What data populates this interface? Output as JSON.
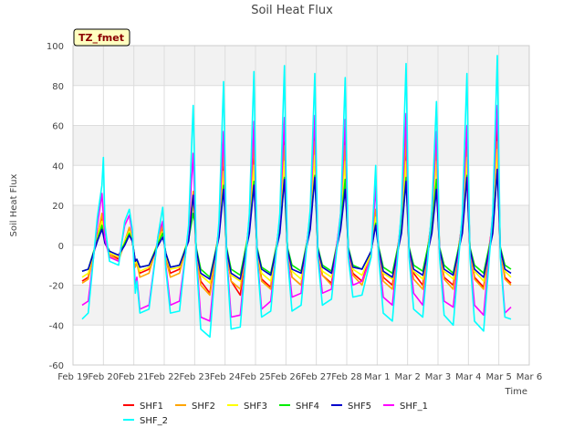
{
  "chart_data": {
    "type": "line",
    "title": "Soil Heat Flux",
    "xlabel": "Time",
    "ylabel": "Soil Heat Flux",
    "site_label": "TZ_fmet",
    "ylim": [
      -60,
      100
    ],
    "yticks": [
      -60,
      -40,
      -20,
      0,
      20,
      40,
      60,
      80,
      100
    ],
    "xlim": [
      0,
      15
    ],
    "xtick_labels": [
      "Feb 19",
      "Feb 20",
      "Feb 21",
      "Feb 22",
      "Feb 23",
      "Feb 24",
      "Feb 25",
      "Feb 26",
      "Feb 27",
      "Feb 28",
      "Mar 1",
      "Mar 2",
      "Mar 3",
      "Mar 4",
      "Mar 5",
      "Mar 6"
    ],
    "grid": true,
    "shaded_bands": true,
    "legend_position": "bottom",
    "x_unit": "days since Feb 19",
    "series": [
      {
        "name": "SHF1",
        "color": "#ff0000",
        "x": [
          0.3,
          0.5,
          0.8,
          0.95,
          1.0,
          1.05,
          1.2,
          1.5,
          1.7,
          1.85,
          1.95,
          2.05,
          2.1,
          2.2,
          2.5,
          2.8,
          2.95,
          3.0,
          3.05,
          3.2,
          3.5,
          3.8,
          3.95,
          4.0,
          4.05,
          4.2,
          4.5,
          4.8,
          4.95,
          5.0,
          5.05,
          5.2,
          5.5,
          5.8,
          5.95,
          6.0,
          6.05,
          6.2,
          6.5,
          6.8,
          6.95,
          7.0,
          7.05,
          7.2,
          7.5,
          7.8,
          7.95,
          8.0,
          8.05,
          8.2,
          8.5,
          8.8,
          8.95,
          9.0,
          9.05,
          9.2,
          9.5,
          9.8,
          9.95,
          10.0,
          10.05,
          10.2,
          10.5,
          10.8,
          10.95,
          11.0,
          11.05,
          11.2,
          11.5,
          11.8,
          11.95,
          12.0,
          12.05,
          12.2,
          12.5,
          12.8,
          12.95,
          13.0,
          13.05,
          13.2,
          13.5,
          13.8,
          13.95,
          14.0,
          14.05,
          14.2,
          14.4
        ],
        "y": [
          -18,
          -16,
          5,
          14,
          8,
          3,
          -4,
          -7,
          2,
          8,
          3,
          -10,
          -8,
          -14,
          -12,
          2,
          8,
          2,
          -6,
          -14,
          -12,
          4,
          25,
          20,
          -2,
          -18,
          -24,
          8,
          45,
          20,
          -2,
          -18,
          -25,
          12,
          50,
          20,
          -2,
          -17,
          -21,
          12,
          52,
          22,
          -2,
          -16,
          -20,
          14,
          55,
          25,
          -2,
          -15,
          -19,
          14,
          52,
          22,
          -2,
          -14,
          -18,
          -4,
          16,
          8,
          -2,
          -16,
          -20,
          12,
          52,
          22,
          -2,
          -14,
          -20,
          14,
          52,
          22,
          -2,
          -16,
          -20,
          12,
          54,
          25,
          -2,
          -16,
          -21,
          12,
          60,
          28,
          -2,
          -16,
          -19
        ]
      },
      {
        "name": "SHF2",
        "color": "#ffa500",
        "x": [
          0.3,
          0.5,
          0.8,
          0.95,
          1.0,
          1.05,
          1.2,
          1.5,
          1.7,
          1.85,
          1.95,
          2.05,
          2.1,
          2.2,
          2.5,
          2.8,
          2.95,
          3.0,
          3.05,
          3.2,
          3.5,
          3.8,
          3.95,
          4.0,
          4.05,
          4.2,
          4.5,
          4.8,
          4.95,
          5.0,
          5.05,
          5.2,
          5.5,
          5.8,
          5.95,
          6.0,
          6.05,
          6.2,
          6.5,
          6.8,
          6.95,
          7.0,
          7.05,
          7.2,
          7.5,
          7.8,
          7.95,
          8.0,
          8.05,
          8.2,
          8.5,
          8.8,
          8.95,
          9.0,
          9.05,
          9.2,
          9.5,
          9.8,
          9.95,
          10.0,
          10.05,
          10.2,
          10.5,
          10.8,
          10.95,
          11.0,
          11.05,
          11.2,
          11.5,
          11.8,
          11.95,
          12.0,
          12.05,
          12.2,
          12.5,
          12.8,
          12.95,
          13.0,
          13.05,
          13.2,
          13.5,
          13.8,
          13.95,
          14.0,
          14.05,
          14.2,
          14.4
        ],
        "y": [
          -19,
          -17,
          4,
          16,
          9,
          2,
          -5,
          -8,
          2,
          9,
          3,
          -11,
          -9,
          -16,
          -14,
          2,
          10,
          2,
          -7,
          -16,
          -14,
          4,
          27,
          20,
          -2,
          -20,
          -25,
          6,
          49,
          20,
          -2,
          -18,
          -22,
          10,
          54,
          20,
          -2,
          -18,
          -22,
          10,
          50,
          20,
          -2,
          -16,
          -20,
          12,
          52,
          24,
          -2,
          -15,
          -20,
          12,
          50,
          22,
          -2,
          -15,
          -20,
          -4,
          18,
          8,
          -2,
          -18,
          -22,
          10,
          55,
          22,
          -2,
          -17,
          -22,
          12,
          50,
          22,
          -2,
          -17,
          -22,
          10,
          52,
          24,
          -2,
          -17,
          -22,
          10,
          52,
          26,
          -2,
          -17,
          -20
        ]
      },
      {
        "name": "SHF3",
        "color": "#ffff00",
        "x": [
          0.3,
          0.5,
          0.8,
          0.95,
          1.0,
          1.05,
          1.2,
          1.5,
          1.7,
          1.85,
          1.95,
          2.05,
          2.1,
          2.2,
          2.5,
          2.8,
          2.95,
          3.0,
          3.05,
          3.2,
          3.5,
          3.8,
          3.95,
          4.0,
          4.05,
          4.2,
          4.5,
          4.8,
          4.95,
          5.0,
          5.05,
          5.2,
          5.5,
          5.8,
          5.95,
          6.0,
          6.05,
          6.2,
          6.5,
          6.8,
          6.95,
          7.0,
          7.05,
          7.2,
          7.5,
          7.8,
          7.95,
          8.0,
          8.05,
          8.2,
          8.5,
          8.8,
          8.95,
          9.0,
          9.05,
          9.2,
          9.5,
          9.8,
          9.95,
          10.0,
          10.05,
          10.2,
          10.5,
          10.8,
          10.95,
          11.0,
          11.05,
          11.2,
          11.5,
          11.8,
          11.95,
          12.0,
          12.05,
          12.2,
          12.5,
          12.8,
          12.95,
          13.0,
          13.05,
          13.2,
          13.5,
          13.8,
          13.95,
          14.0,
          14.05,
          14.2,
          14.4
        ],
        "y": [
          -16,
          -14,
          4,
          12,
          7,
          2,
          -4,
          -6,
          2,
          7,
          2,
          -9,
          -8,
          -13,
          -11,
          2,
          7,
          2,
          -5,
          -12,
          -11,
          4,
          20,
          15,
          -2,
          -15,
          -19,
          6,
          37,
          16,
          -2,
          -15,
          -18,
          10,
          40,
          18,
          -2,
          -14,
          -18,
          10,
          42,
          18,
          -2,
          -13,
          -17,
          12,
          45,
          20,
          -2,
          -13,
          -16,
          12,
          42,
          18,
          -2,
          -12,
          -15,
          -4,
          14,
          7,
          -2,
          -14,
          -17,
          10,
          42,
          18,
          -2,
          -13,
          -17,
          12,
          42,
          18,
          -2,
          -13,
          -17,
          10,
          44,
          20,
          -2,
          -13,
          -18,
          10,
          48,
          22,
          -2,
          -13,
          -16
        ]
      },
      {
        "name": "SHF4",
        "color": "#00ee00",
        "x": [
          0.3,
          0.5,
          0.8,
          0.95,
          1.0,
          1.05,
          1.2,
          1.5,
          1.7,
          1.85,
          1.95,
          2.05,
          2.1,
          2.2,
          2.5,
          2.8,
          2.95,
          3.0,
          3.05,
          3.2,
          3.5,
          3.8,
          3.95,
          4.0,
          4.05,
          4.2,
          4.5,
          4.8,
          4.95,
          5.0,
          5.05,
          5.2,
          5.5,
          5.8,
          5.95,
          6.0,
          6.05,
          6.2,
          6.5,
          6.8,
          6.95,
          7.0,
          7.05,
          7.2,
          7.5,
          7.8,
          7.95,
          8.0,
          8.05,
          8.2,
          8.5,
          8.8,
          8.95,
          9.0,
          9.05,
          9.2,
          9.5,
          9.8,
          9.95,
          10.0,
          10.05,
          10.2,
          10.5,
          10.8,
          10.95,
          11.0,
          11.05,
          11.2,
          11.5,
          11.8,
          11.95,
          12.0,
          12.05,
          12.2,
          12.5,
          12.8,
          12.95,
          13.0,
          13.05,
          13.2,
          13.5,
          13.8,
          13.95,
          14.0,
          14.05,
          14.2,
          14.4
        ],
        "y": [
          -13,
          -12,
          3,
          10,
          6,
          2,
          -3,
          -5,
          1,
          6,
          2,
          -8,
          -7,
          -11,
          -10,
          1,
          6,
          1,
          -4,
          -11,
          -10,
          3,
          16,
          12,
          -1,
          -12,
          -16,
          5,
          30,
          12,
          -1,
          -12,
          -15,
          8,
          32,
          14,
          -1,
          -11,
          -14,
          8,
          34,
          14,
          -1,
          -10,
          -13,
          10,
          35,
          16,
          -1,
          -10,
          -13,
          10,
          33,
          14,
          -1,
          -10,
          -12,
          -3,
          11,
          5,
          -1,
          -11,
          -14,
          8,
          34,
          14,
          -1,
          -10,
          -13,
          9,
          33,
          14,
          -1,
          -10,
          -14,
          8,
          35,
          16,
          -1,
          -10,
          -14,
          8,
          38,
          18,
          -1,
          -10,
          -12
        ]
      },
      {
        "name": "SHF5",
        "color": "#0000cc",
        "x": [
          0.3,
          0.5,
          0.8,
          0.95,
          1.0,
          1.05,
          1.2,
          1.5,
          1.7,
          1.85,
          1.95,
          2.05,
          2.1,
          2.2,
          2.5,
          2.8,
          2.95,
          3.0,
          3.05,
          3.2,
          3.5,
          3.8,
          3.95,
          4.0,
          4.05,
          4.2,
          4.5,
          4.8,
          4.95,
          5.0,
          5.05,
          5.2,
          5.5,
          5.8,
          5.95,
          6.0,
          6.05,
          6.2,
          6.5,
          6.8,
          6.95,
          7.0,
          7.05,
          7.2,
          7.5,
          7.8,
          7.95,
          8.0,
          8.05,
          8.2,
          8.5,
          8.8,
          8.95,
          9.0,
          9.05,
          9.2,
          9.5,
          9.8,
          9.95,
          10.0,
          10.05,
          10.2,
          10.5,
          10.8,
          10.95,
          11.0,
          11.05,
          11.2,
          11.5,
          11.8,
          11.95,
          12.0,
          12.05,
          12.2,
          12.5,
          12.8,
          12.95,
          13.0,
          13.05,
          13.2,
          13.5,
          13.8,
          13.95,
          14.0,
          14.05,
          14.2,
          14.4
        ],
        "y": [
          -13,
          -12,
          2,
          8,
          5,
          1,
          -3,
          -5,
          0,
          5,
          2,
          -8,
          -7,
          -11,
          -10,
          0,
          4,
          1,
          -4,
          -11,
          -10,
          2,
          25,
          16,
          -2,
          -14,
          -17,
          4,
          28,
          16,
          -2,
          -14,
          -17,
          6,
          30,
          16,
          -2,
          -12,
          -15,
          6,
          33,
          18,
          -2,
          -12,
          -14,
          8,
          34,
          18,
          -2,
          -11,
          -14,
          8,
          28,
          16,
          -2,
          -11,
          -12,
          -3,
          10,
          4,
          -2,
          -13,
          -16,
          6,
          32,
          16,
          -2,
          -12,
          -15,
          6,
          28,
          14,
          -2,
          -12,
          -15,
          6,
          34,
          16,
          -2,
          -12,
          -16,
          6,
          38,
          18,
          -2,
          -12,
          -14
        ]
      },
      {
        "name": "SHF_1",
        "color": "#ff00ff",
        "x": [
          0.3,
          0.5,
          0.8,
          0.95,
          1.0,
          1.05,
          1.2,
          1.5,
          1.7,
          1.85,
          1.95,
          2.05,
          2.1,
          2.2,
          2.5,
          2.8,
          2.95,
          3.0,
          3.05,
          3.2,
          3.5,
          3.8,
          3.95,
          4.0,
          4.05,
          4.2,
          4.5,
          4.8,
          4.95,
          5.0,
          5.05,
          5.2,
          5.5,
          5.8,
          5.95,
          6.0,
          6.05,
          6.2,
          6.5,
          6.8,
          6.95,
          7.0,
          7.05,
          7.2,
          7.5,
          7.8,
          7.95,
          8.0,
          8.05,
          8.2,
          8.5,
          8.8,
          8.95,
          9.0,
          9.05,
          9.2,
          9.5,
          9.8,
          9.95,
          10.0,
          10.05,
          10.2,
          10.5,
          10.8,
          10.95,
          11.0,
          11.05,
          11.2,
          11.5,
          11.8,
          11.95,
          12.0,
          12.05,
          12.2,
          12.5,
          12.8,
          12.95,
          13.0,
          13.05,
          13.2,
          13.5,
          13.8,
          13.95,
          14.0,
          14.05,
          14.2,
          14.4
        ],
        "y": [
          -30,
          -28,
          10,
          26,
          15,
          3,
          -6,
          -8,
          10,
          15,
          6,
          -20,
          -16,
          -32,
          -30,
          5,
          12,
          4,
          -10,
          -30,
          -28,
          8,
          46,
          25,
          -4,
          -36,
          -38,
          10,
          57,
          25,
          -4,
          -36,
          -35,
          14,
          62,
          28,
          -4,
          -32,
          -28,
          14,
          64,
          30,
          -4,
          -26,
          -24,
          16,
          65,
          30,
          -4,
          -24,
          -22,
          16,
          63,
          28,
          -4,
          -20,
          -18,
          -6,
          30,
          10,
          -4,
          -26,
          -30,
          16,
          66,
          28,
          -4,
          -24,
          -30,
          16,
          57,
          26,
          -4,
          -28,
          -31,
          14,
          60,
          28,
          -4,
          -30,
          -35,
          16,
          70,
          32,
          -4,
          -34,
          -31
        ]
      },
      {
        "name": "SHF_2",
        "color": "#00ffff",
        "x": [
          0.3,
          0.5,
          0.8,
          0.95,
          1.0,
          1.05,
          1.2,
          1.5,
          1.7,
          1.85,
          1.95,
          2.05,
          2.1,
          2.2,
          2.5,
          2.8,
          2.95,
          3.0,
          3.05,
          3.2,
          3.5,
          3.8,
          3.95,
          4.0,
          4.05,
          4.2,
          4.5,
          4.8,
          4.95,
          5.0,
          5.05,
          5.2,
          5.5,
          5.8,
          5.95,
          6.0,
          6.05,
          6.2,
          6.5,
          6.8,
          6.95,
          7.0,
          7.05,
          7.2,
          7.5,
          7.8,
          7.95,
          8.0,
          8.05,
          8.2,
          8.5,
          8.8,
          8.95,
          9.0,
          9.05,
          9.2,
          9.5,
          9.8,
          9.95,
          10.0,
          10.05,
          10.2,
          10.5,
          10.8,
          10.95,
          11.0,
          11.05,
          11.2,
          11.5,
          11.8,
          11.95,
          12.0,
          12.05,
          12.2,
          12.5,
          12.8,
          12.95,
          13.0,
          13.05,
          13.2,
          13.5,
          13.8,
          13.95,
          14.0,
          14.05,
          14.2,
          14.4
        ],
        "y": [
          -37,
          -34,
          14,
          30,
          44,
          10,
          -8,
          -10,
          12,
          18,
          8,
          -24,
          -18,
          -34,
          -32,
          5,
          19,
          6,
          -12,
          -34,
          -33,
          10,
          70,
          40,
          -6,
          -42,
          -46,
          12,
          82,
          40,
          -6,
          -42,
          -41,
          16,
          87,
          40,
          -6,
          -36,
          -33,
          16,
          90,
          40,
          -6,
          -33,
          -30,
          18,
          86,
          40,
          -6,
          -30,
          -27,
          16,
          84,
          40,
          -6,
          -26,
          -25,
          -6,
          40,
          14,
          -6,
          -34,
          -38,
          18,
          91,
          44,
          -6,
          -32,
          -36,
          18,
          72,
          38,
          -6,
          -35,
          -40,
          16,
          86,
          40,
          -6,
          -38,
          -43,
          16,
          95,
          44,
          -6,
          -36,
          -37
        ]
      }
    ]
  }
}
